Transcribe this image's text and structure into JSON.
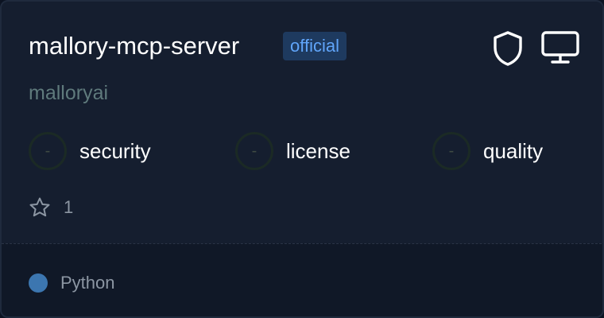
{
  "server": {
    "name": "mallory-mcp-server",
    "badge": "official",
    "owner": "malloryai"
  },
  "header_icons": [
    "shield-icon",
    "monitor-icon"
  ],
  "metrics": [
    {
      "label": "security",
      "value": "-"
    },
    {
      "label": "license",
      "value": "-"
    },
    {
      "label": "quality",
      "value": "-"
    }
  ],
  "stars": {
    "count": "1"
  },
  "language": {
    "name": "Python",
    "color": "#3c76b0"
  },
  "colors": {
    "card_bg": "#151e2f",
    "badge_bg": "#1e3a5f",
    "badge_text": "#60a5fa",
    "owner_text": "#5f7a7c"
  }
}
